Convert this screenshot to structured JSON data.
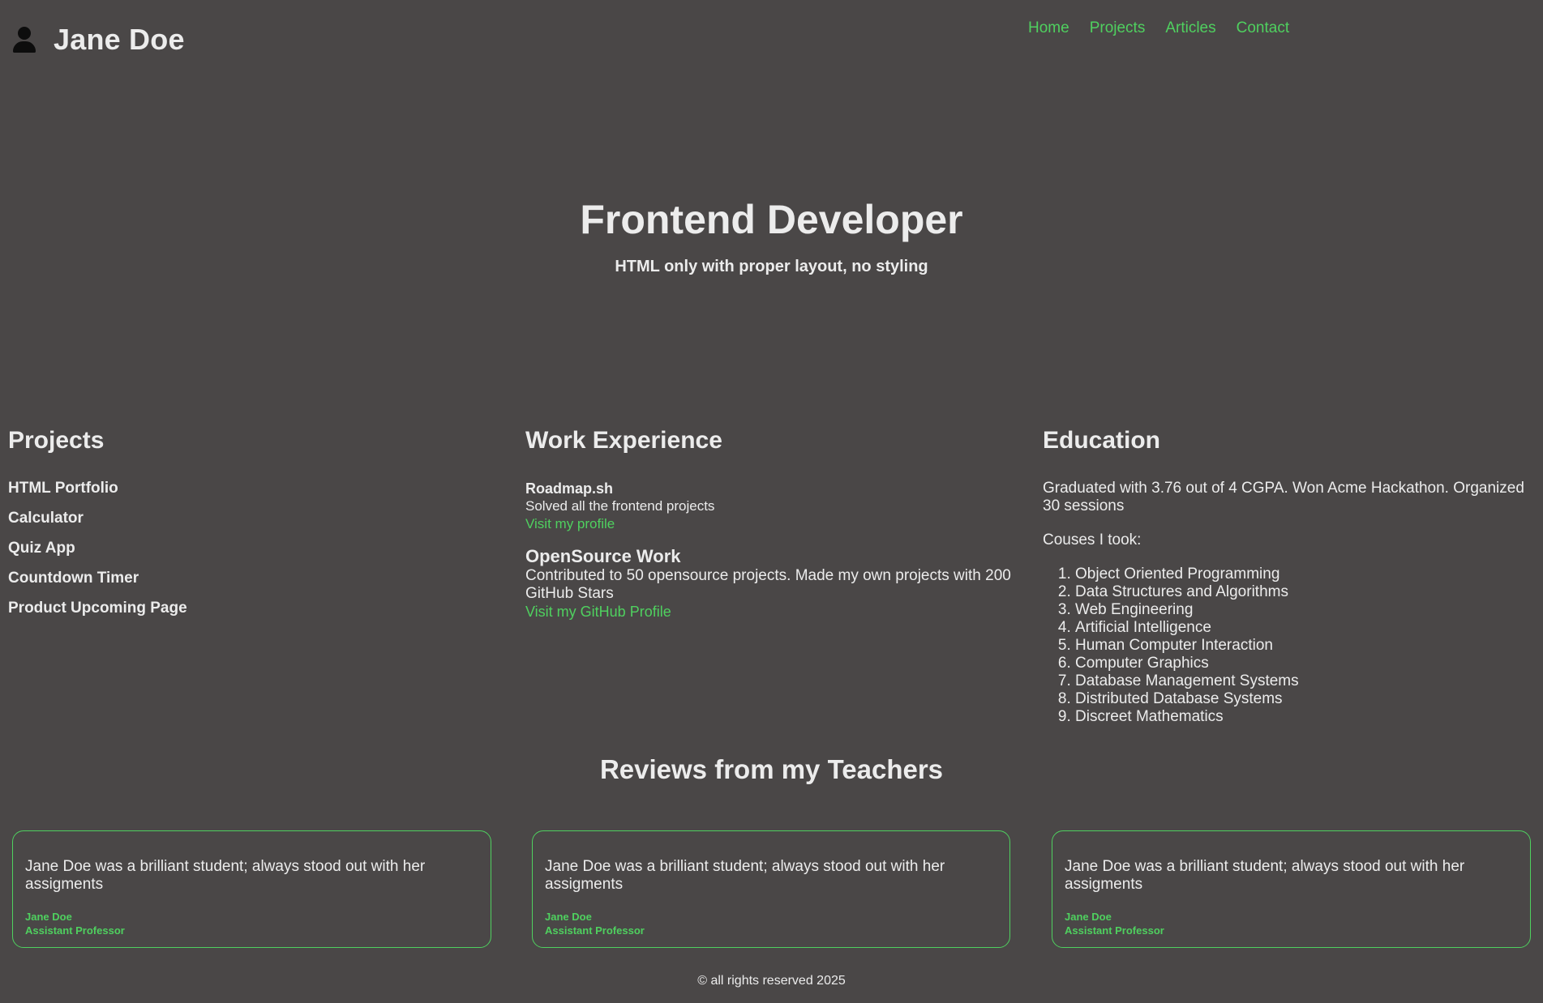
{
  "header": {
    "name": "Jane Doe",
    "nav": [
      "Home",
      "Projects",
      "Articles",
      "Contact"
    ]
  },
  "hero": {
    "title": "Frontend Developer",
    "subtitle": "HTML only with proper layout, no styling"
  },
  "projects": {
    "heading": "Projects",
    "items": [
      "HTML Portfolio",
      "Calculator",
      "Quiz App",
      "Countdown Timer",
      "Product Upcoming Page"
    ]
  },
  "work": {
    "heading": "Work Experience",
    "jobs": [
      {
        "title": "Roadmap.sh",
        "description": "Solved all the frontend projects",
        "link": "Visit my profile"
      },
      {
        "title": "OpenSource Work",
        "description": "Contributed to 50 opensource projects. Made my own projects with 200 GitHub Stars",
        "link": "Visit my GitHub Profile"
      }
    ]
  },
  "education": {
    "heading": "Education",
    "summary": "Graduated with 3.76 out of 4 CGPA. Won Acme Hackathon. Organized 30 sessions",
    "courses_label": "Couses I took:",
    "courses": [
      "Object Oriented Programming",
      "Data Structures and Algorithms",
      "Web Engineering",
      "Artificial Intelligence",
      "Human Computer Interaction",
      "Computer Graphics",
      "Database Management Systems",
      "Distributed Database Systems",
      "Discreet Mathematics"
    ]
  },
  "reviews": {
    "heading": "Reviews from my Teachers",
    "items": [
      {
        "text": "Jane Doe was a brilliant student; always stood out with her assigments",
        "author": "Jane Doe",
        "role": "Assistant Professor"
      },
      {
        "text": "Jane Doe was a brilliant student; always stood out with her assigments",
        "author": "Jane Doe",
        "role": "Assistant Professor"
      },
      {
        "text": "Jane Doe was a brilliant student; always stood out with her assigments",
        "author": "Jane Doe",
        "role": "Assistant Professor"
      }
    ]
  },
  "footer": {
    "text": "© all rights reserved 2025"
  },
  "colors": {
    "background": "#4a4747",
    "accent": "#4fd05f",
    "text": "#ececec"
  },
  "icons": {
    "avatar": "user-avatar-icon"
  }
}
